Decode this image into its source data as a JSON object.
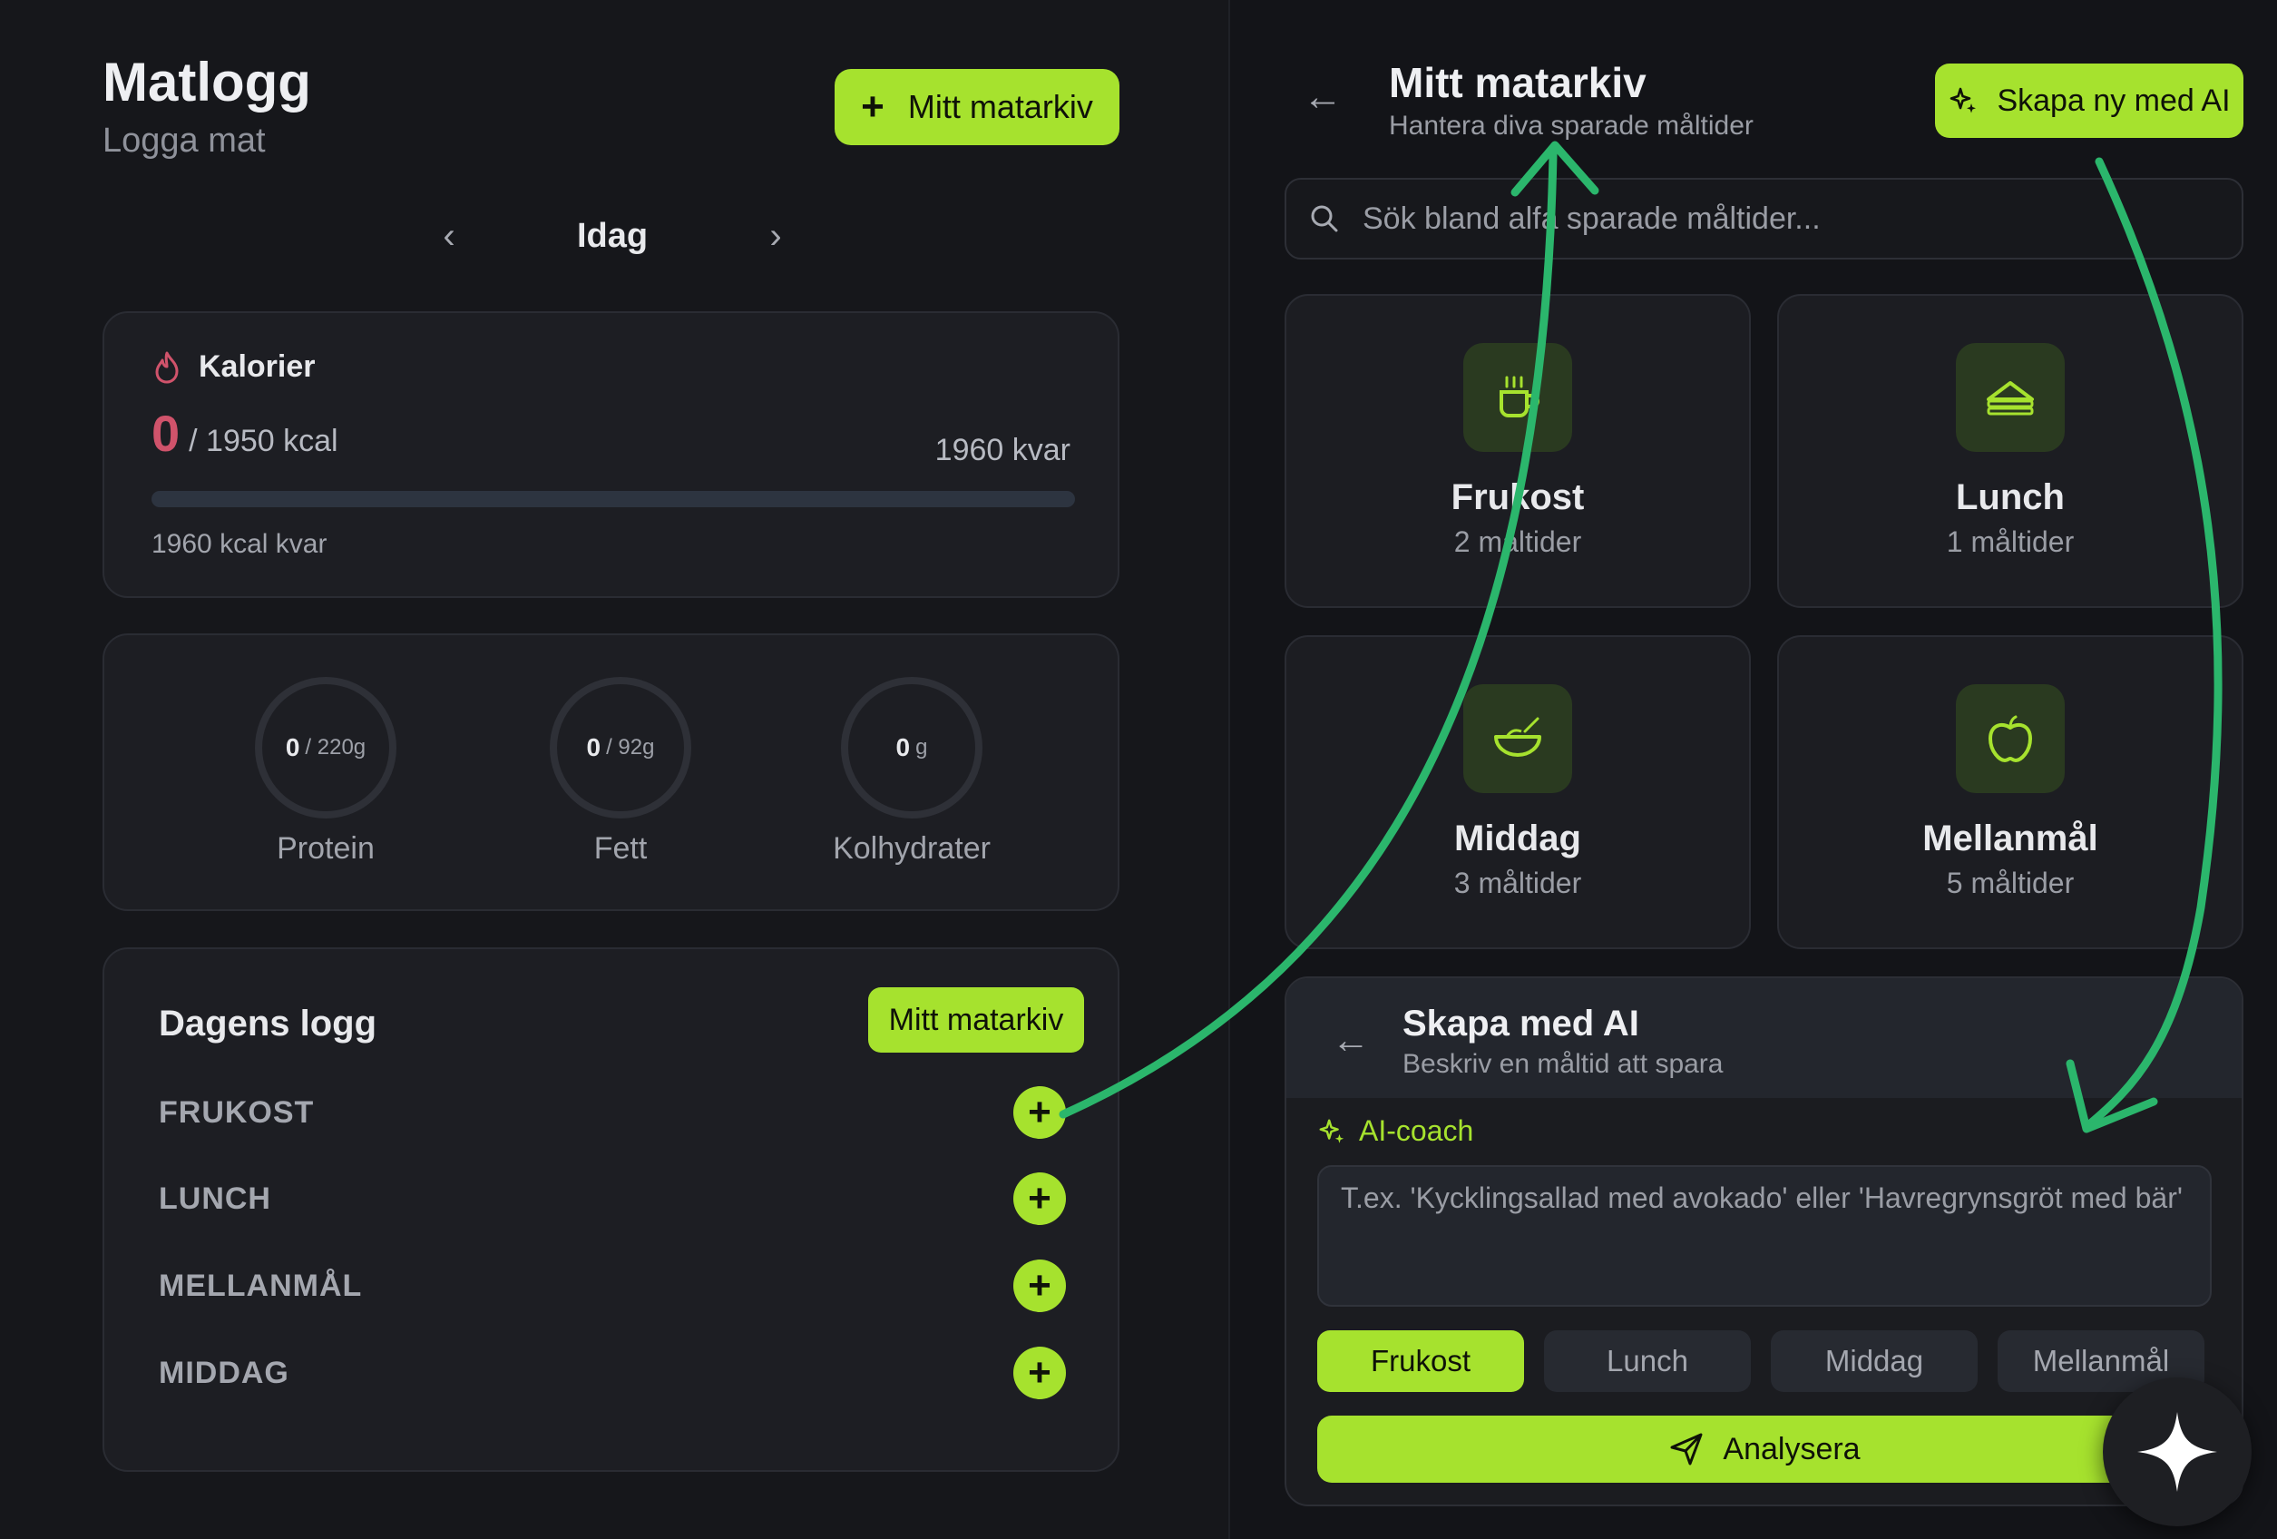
{
  "left": {
    "title": "Matlogg",
    "subtitle": "Logga mat",
    "top_button": "Mitt matarkiv",
    "date_label": "Idag",
    "calories": {
      "label": "Kalorier",
      "consumed": "0",
      "goal_text": "/ 1950 kcal",
      "remaining_text": "1960 kvar",
      "note": "1960 kcal kvar",
      "progress": 0
    },
    "macros": [
      {
        "value": "0",
        "unit": "/ 220g",
        "name": "Protein"
      },
      {
        "value": "0",
        "unit": "/ 92g",
        "name": "Fett"
      },
      {
        "value": "0",
        "unit": "g",
        "name": "Kolhydrater"
      }
    ],
    "log": {
      "title": "Dagens logg",
      "button": "Mitt matarkiv",
      "meals": [
        "FRUKOST",
        "LUNCH",
        "MELLANMÅL",
        "MIDDAG"
      ]
    }
  },
  "right": {
    "title": "Mitt matarkiv",
    "subtitle": "Hantera diva sparade måltider",
    "ai_button": "Skapa ny med AI",
    "search_placeholder": "Sök bland alfa sparade måltider...",
    "categories": [
      {
        "name": "Frukost",
        "count": "2 måltider",
        "icon": "coffee-cup-icon"
      },
      {
        "name": "Lunch",
        "count": "1 måltider",
        "icon": "sandwich-icon"
      },
      {
        "name": "Middag",
        "count": "3 måltider",
        "icon": "bowl-icon"
      },
      {
        "name": "Mellanmål",
        "count": "5 måltider",
        "icon": "apple-icon"
      }
    ],
    "ai_panel": {
      "title": "Skapa med AI",
      "subtitle": "Beskriv en måltid att spara",
      "coach_label": "AI-coach",
      "textarea_placeholder": "T.ex. 'Kycklingsallad med avokado' eller 'Havregrynsgröt med bär'",
      "segments": [
        "Frukost",
        "Lunch",
        "Middag",
        "Mellanmål"
      ],
      "selected_segment": "Frukost",
      "analyze_button": "Analysera"
    }
  },
  "colors": {
    "accent": "#a6e22e",
    "calorie_value": "#d0536b",
    "annotation_arrow": "#2bb66c",
    "background": "#141519",
    "card": "#1d1e23"
  }
}
